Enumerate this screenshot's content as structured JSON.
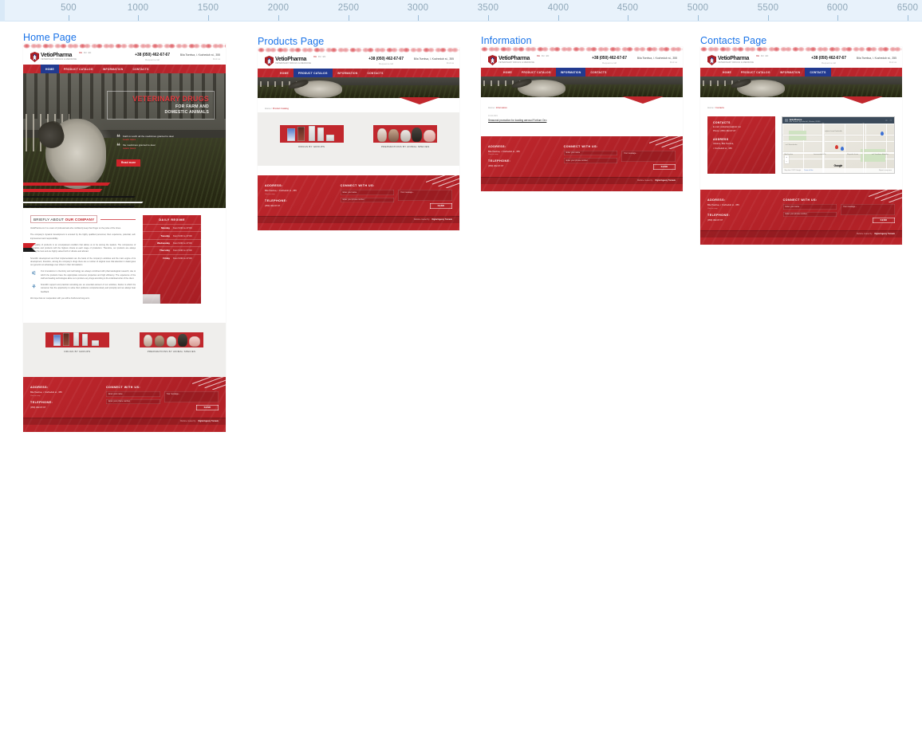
{
  "ruler": {
    "unit_step": 500,
    "ticks": [
      500,
      1000,
      1500,
      2000,
      2500,
      3000,
      3500,
      4000,
      4500,
      5000,
      5500,
      6000,
      6500
    ]
  },
  "frames": [
    {
      "title": "Home Page"
    },
    {
      "title": "Products Page"
    },
    {
      "title": "Information"
    },
    {
      "title": "Contacts Page"
    }
  ],
  "brand": {
    "name": "VetioPharma",
    "tagline": "VETERINARY DRUGS & MEDICINE",
    "accent": "#c1272d",
    "nav_active_color": "#223a8f"
  },
  "header": {
    "languages": [
      "UA",
      "RU",
      "EN"
    ],
    "active_language": "UA",
    "phone": "+38 (050) 462-67-67",
    "phone_caption": "Request a call",
    "address": "Bila Tserkva, i. Kozhedub st., 355",
    "address_caption": "Find us"
  },
  "nav": {
    "items": [
      {
        "label": "HOME"
      },
      {
        "label": "PRODUCT CATALOG"
      },
      {
        "label": "INFORMATION"
      },
      {
        "label": "CONTACTS"
      }
    ],
    "active_per_frame": [
      "HOME",
      "PRODUCT CATALOG",
      "INFORMATION",
      "CONTACTS"
    ]
  },
  "hero": {
    "title_line1": "VETERINARY DRUGS",
    "title_line2": "FOR FARM AND",
    "title_line3": "DOMESTIC ANIMALS",
    "quotes": [
      {
        "text": "Faith is worth all the medicines granted to dear",
        "link": "Learn more"
      },
      {
        "text": "the medicines granted to dear",
        "link": "Learn more"
      }
    ],
    "button": "Read more"
  },
  "breadcrumbs": {
    "home": "Home",
    "separator": "/",
    "products": "Product Catalog",
    "information": "Information",
    "contacts": "Contacts"
  },
  "about": {
    "heading_normal": "BRIEFLY ABOUT",
    "heading_bold": "OUR COMPANY",
    "paragraphs": [
      "VetioPharma LLC is a team of professionals who confidently keep their finger on the pulse of the times.",
      "The company's dynamic development is ensured by the highly qualified personnel, their experience, potential, self-improvement and responsibility.",
      "The quality of products is an unsurpassed condition that allows us to be among the leaders. The competence of specialists and products with the highest criteria at each stage of production. Therefore, our products are always among the best and are highly valued both in Ukraine and abroad.",
      "Scientific development and their implementation are the basis of the company's activities and the main engine of its development, therefore, among the company's drugs there are a number of original ones that attention in detail gives our generics an advantage over others in their formulations."
    ],
    "features": [
      "Our innovations in chemistry and technology are always combined with pharmacological research, due to which the products have the appropriate consumer properties and high efficiency. The experience of the staff and leading technologies allow us to produce any drugs according to the individual order of the client.",
      "Scientific support and practical consulting are an essential element of our activities, thanks to which the consumer has the opportunity to solve their problems comprehensively and promptly and we always hear feedback."
    ],
    "closing": "We hope that our cooperation with you will be fruitful and long-term."
  },
  "regime": {
    "title": "DAILY REGIME",
    "rows": [
      {
        "day": "Monday",
        "hours": "from 9:00 to 17:00"
      },
      {
        "day": "Tuesday",
        "hours": "from 9:00 to 17:00"
      },
      {
        "day": "Wednesday",
        "hours": "from 9:00 to 17:00"
      },
      {
        "day": "Thursday",
        "hours": "from 9:00 to 17:00"
      },
      {
        "day": "Friday",
        "hours": "from 9:00 to 17:00"
      }
    ]
  },
  "catalog": {
    "cards": [
      {
        "caption": "DRUGS BY GROUPS"
      },
      {
        "caption": "PREPARATIONS BY ANIMAL SPECIES"
      }
    ]
  },
  "news": {
    "date": "10.02.2021",
    "title": "Seasonal promotion for loading aerosol Fortium Oro"
  },
  "contacts_page": {
    "contacts_heading": "CONTACTS",
    "email": "E-mail: vetiopharma@ukr.net",
    "phone": "Phone: (050) 462-67-67",
    "address_heading": "ADDRESS",
    "address_line1": "Ukraine, Bila Tserkva,",
    "address_line2": "i. Kozhedub st., 355"
  },
  "map": {
    "title": "VetioPharma",
    "subtitle": "Bila Tserkva, Kyivska obl., Ukraine, 09100",
    "link": "View larger map",
    "zoom_in": "+",
    "zoom_out": "−",
    "logo": "Google",
    "attribution": "Map data ©2021 Google",
    "terms": "Terms of Use",
    "report": "Report a map error",
    "labels": [
      "vulytsia Ivana Kozhedub",
      "vul. Shevchenka",
      "Levanevskoho St",
      "Bila Tserkva",
      "Skvyrske shose",
      "vul. Yaroslava Mudroho"
    ]
  },
  "footer": {
    "address_heading": "ADDRESS:",
    "address_value": "Bila Tserkva, i. Kozhedub st., 355",
    "address_sub": "View on map",
    "telephone_heading": "TELEPHONE:",
    "telephone_value": "(050) 462-67-67",
    "connect_heading": "CONNECT WITH US:",
    "name_placeholder": "Enter your name",
    "phone_placeholder": "Enter your phone number",
    "message_placeholder": "Your message...",
    "send_label": "SEND",
    "copyright": "Website created by",
    "author": "Digital Agency Tornado"
  }
}
